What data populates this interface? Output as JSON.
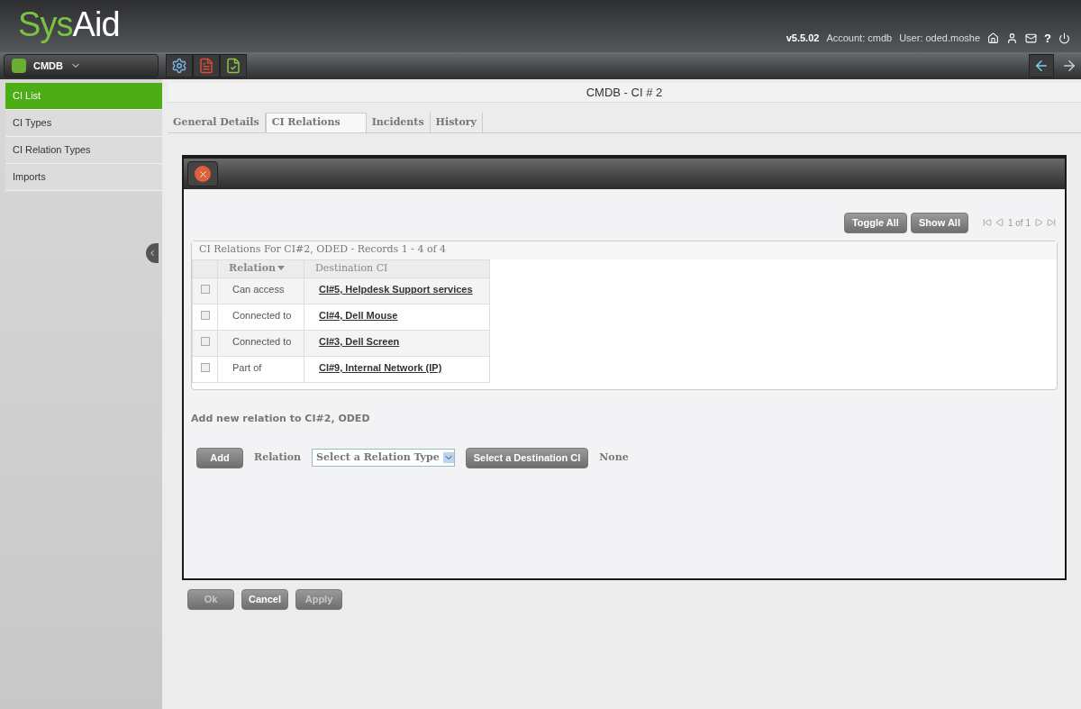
{
  "logo": {
    "prefix": "Sys",
    "suffix": "Aid"
  },
  "header": {
    "version": "v5.5.02",
    "account": "Account: cmdb",
    "user": "User: oded.moshe",
    "help": "?"
  },
  "module_menu": {
    "label": "CMDB"
  },
  "sidebar": {
    "items": [
      {
        "label": "CI List",
        "selected": true
      },
      {
        "label": "CI Types",
        "selected": false
      },
      {
        "label": "CI Relation Types",
        "selected": false
      },
      {
        "label": "Imports",
        "selected": false
      }
    ]
  },
  "page_title": "CMDB - CI # 2",
  "tabs": [
    {
      "label": "General Details",
      "selected": false
    },
    {
      "label": "CI Relations",
      "selected": true
    },
    {
      "label": "Incidents",
      "selected": false
    },
    {
      "label": "History",
      "selected": false
    }
  ],
  "grid_buttons": [
    "Toggle All",
    "Show All"
  ],
  "pager": "1 of 1",
  "table": {
    "caption": "CI Relations For CI#2, ODED - Records 1 - 4 of 4",
    "columns": [
      "Relation",
      "Destination CI"
    ],
    "rows": [
      {
        "checked": false,
        "relation": "Can access",
        "destination": "CI#5, Helpdesk Support services"
      },
      {
        "checked": false,
        "relation": "Connected to",
        "destination": "CI#4, Dell Mouse"
      },
      {
        "checked": false,
        "relation": "Connected to",
        "destination": "CI#3, Dell Screen"
      },
      {
        "checked": false,
        "relation": "Part of",
        "destination": "CI#9, Internal Network (IP)"
      }
    ]
  },
  "add_section": {
    "title": "Add new relation to CI#2, ODED",
    "add_button": "Add",
    "relation_label": "Relation",
    "relation_select": "Select a Relation Type",
    "destination_button": "Select a Destination CI",
    "destination_value": "None"
  },
  "footer_buttons": [
    {
      "label": "Ok",
      "disabled": true
    },
    {
      "label": "Cancel",
      "disabled": false
    },
    {
      "label": "Apply",
      "disabled": true
    }
  ]
}
